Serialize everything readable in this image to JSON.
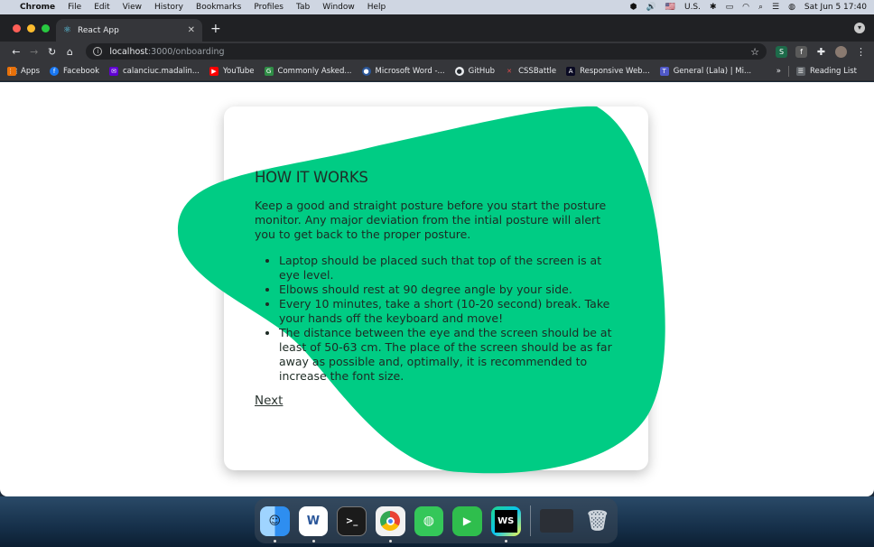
{
  "menubar": {
    "app_name": "Chrome",
    "items": [
      "File",
      "Edit",
      "View",
      "History",
      "Bookmarks",
      "Profiles",
      "Tab",
      "Window",
      "Help"
    ],
    "input_source": "U.S.",
    "datetime": "Sat Jun 5  17:40"
  },
  "browser": {
    "tab_title": "React App",
    "url_host": "localhost",
    "url_path": ":3000/onboarding",
    "bookmarks": [
      {
        "label": "Apps",
        "icon": "apps-grid-icon",
        "color": "#e8710a"
      },
      {
        "label": "Facebook",
        "icon": "facebook-icon",
        "color": "#1877f2"
      },
      {
        "label": "calanciuc.madalin...",
        "icon": "mail-icon",
        "color": "#6001d2"
      },
      {
        "label": "YouTube",
        "icon": "youtube-icon",
        "color": "#ff0000"
      },
      {
        "label": "Commonly Asked...",
        "icon": "gfg-icon",
        "color": "#2f8d46"
      },
      {
        "label": "Microsoft Word -...",
        "icon": "word-icon",
        "color": "#2b579a"
      },
      {
        "label": "GitHub",
        "icon": "github-icon",
        "color": "#24292e"
      },
      {
        "label": "CSSBattle",
        "icon": "cssbattle-icon",
        "color": "#e04b4b"
      },
      {
        "label": "Responsive Web...",
        "icon": "freecodecamp-icon",
        "color": "#0a0a23"
      },
      {
        "label": "General (Lala) | Mi...",
        "icon": "teams-icon",
        "color": "#5059c9"
      }
    ],
    "more_label": "»",
    "reading_list": "Reading List"
  },
  "onboarding": {
    "heading": "HOW IT WORKS",
    "intro": "Keep a good and straight posture before you start the posture monitor. Any major deviation from the intial posture will alert you to get back to the proper posture.",
    "tips": [
      "Laptop should be placed such that top of the screen is at eye level.",
      "Elbows should rest at 90 degree angle by your side.",
      "Every 10 minutes, take a short (10-20 second) break. Take your hands off the keyboard and move!",
      "The distance between the eye and the screen should be at least of 50-63 cm. The place of the screen should be as far away as possible and, optimally, it is recommended to increase the font size."
    ],
    "next_label": "Next"
  },
  "colors": {
    "blob": "#00cc84",
    "chrome_dark": "#202124",
    "chrome_toolbar": "#35363a"
  },
  "dock": {
    "apps": [
      {
        "name": "finder-icon",
        "glyph": "☺",
        "color": "#3aa0f0"
      },
      {
        "name": "word-icon",
        "glyph": "W",
        "color": "#2b579a"
      },
      {
        "name": "terminal-icon",
        "glyph": ">_",
        "color": "#1b1b1b"
      },
      {
        "name": "chrome-icon",
        "glyph": "◉",
        "color": "#e8e8e8"
      },
      {
        "name": "messages-icon",
        "glyph": "💬",
        "color": "#34c759"
      },
      {
        "name": "facetime-icon",
        "glyph": "▶",
        "color": "#2fbe4d"
      },
      {
        "name": "webstorm-icon",
        "glyph": "WS",
        "color": "#0b0b0b"
      }
    ]
  }
}
